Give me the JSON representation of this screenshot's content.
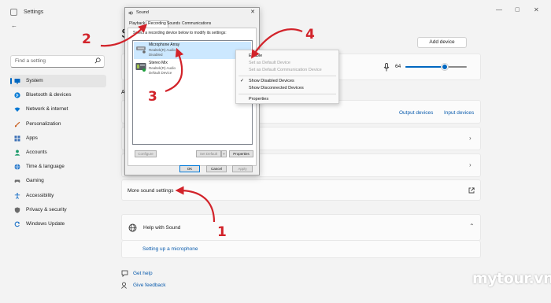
{
  "app": {
    "title": "Settings",
    "min": "—",
    "max": "▢",
    "close": "✕",
    "back": "←"
  },
  "search": {
    "placeholder": "Find a setting"
  },
  "nav": [
    {
      "label": "System",
      "icon": "monitor-icon",
      "color": "#0067c0",
      "active": true
    },
    {
      "label": "Bluetooth & devices",
      "icon": "bluetooth-icon",
      "color": "#0078d4"
    },
    {
      "label": "Network & internet",
      "icon": "wifi-icon",
      "color": "#0078d4"
    },
    {
      "label": "Personalization",
      "icon": "brush-icon",
      "color": "#c75a1a"
    },
    {
      "label": "Apps",
      "icon": "apps-icon",
      "color": "#3a6fb5"
    },
    {
      "label": "Accounts",
      "icon": "person-icon",
      "color": "#1a9a6a"
    },
    {
      "label": "Time & language",
      "icon": "globe-icon",
      "color": "#1f73c8"
    },
    {
      "label": "Gaming",
      "icon": "gamepad-icon",
      "color": "#6b6b6b"
    },
    {
      "label": "Accessibility",
      "icon": "accessibility-icon",
      "color": "#1f73c8"
    },
    {
      "label": "Privacy & security",
      "icon": "shield-icon",
      "color": "#6b6b6b"
    },
    {
      "label": "Windows Update",
      "icon": "update-icon",
      "color": "#1f73c8"
    }
  ],
  "content": {
    "heading_partial": "S",
    "section_partial": "A",
    "add_device": "Add device",
    "volume": {
      "value": "64",
      "level": 0.64
    },
    "output_devices": "Output devices",
    "input_devices": "Input devices",
    "more_sound": "More sound settings",
    "help_with_sound": "Help with Sound",
    "setting_up_mic": "Setting up a microphone",
    "get_help": "Get help",
    "give_feedback": "Give feedback"
  },
  "dialog": {
    "title": "Sound",
    "tabs": [
      "Playback",
      "Recording",
      "Sounds",
      "Communications"
    ],
    "instruction": "Select a recording device below to modify its settings:",
    "devices": [
      {
        "name": "Microphone Array",
        "driver": "Realtek(R) Audio",
        "status": "Disabled"
      },
      {
        "name": "Stereo Mix",
        "driver": "Realtek(R) Audio",
        "status": "Default Device"
      }
    ],
    "configure": "Configure",
    "set_default": "Set Default",
    "properties": "Properties",
    "ok": "OK",
    "cancel": "Cancel",
    "apply": "Apply"
  },
  "context_menu": {
    "enable": "Enable",
    "set_default": "Set as Default Device",
    "set_comm_default": "Set as Default Communication Device",
    "show_disabled": "Show Disabled Devices",
    "show_disconnected": "Show Disconnected Devices",
    "properties": "Properties"
  },
  "annotations": [
    "1",
    "2",
    "3",
    "4"
  ],
  "watermark": "mytour.vn",
  "colors": {
    "accent": "#0067c0",
    "annotation": "#d2232a",
    "selection": "#cce8ff"
  }
}
